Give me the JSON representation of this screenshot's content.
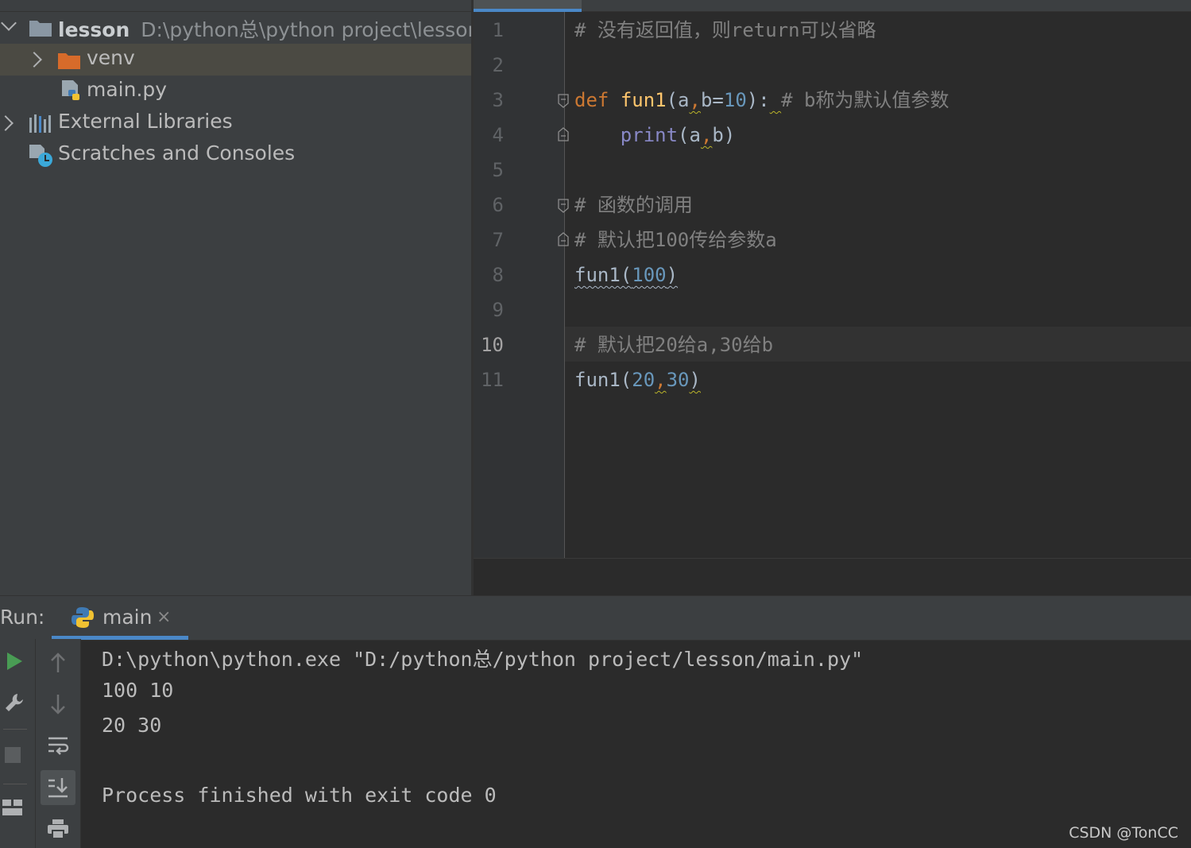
{
  "project_tree": {
    "root": {
      "name": "lesson",
      "path": "D:\\python总\\python project\\lesson"
    },
    "items": [
      {
        "label": "venv",
        "type": "folder",
        "selected": true
      },
      {
        "label": "main.py",
        "type": "python-file"
      },
      {
        "label": "External Libraries",
        "type": "libraries"
      },
      {
        "label": "Scratches and Consoles",
        "type": "scratches"
      }
    ]
  },
  "editor": {
    "current_line": 10,
    "lines": [
      {
        "num": "1",
        "tokens": [
          {
            "t": "# 没有返回值，则return可以省略",
            "c": "comment"
          }
        ]
      },
      {
        "num": "2",
        "tokens": []
      },
      {
        "num": "3",
        "tokens": [
          {
            "t": "def",
            "c": "kw"
          },
          {
            "t": " ",
            "c": "plain"
          },
          {
            "t": "fun1",
            "c": "fn"
          },
          {
            "t": "(a",
            "c": "plain"
          },
          {
            "t": ",",
            "c": "kw",
            "w": "warn"
          },
          {
            "t": "b=",
            "c": "plain"
          },
          {
            "t": "10",
            "c": "num"
          },
          {
            "t": "):",
            "c": "plain"
          },
          {
            "t": " ",
            "c": "plain",
            "w": "warn"
          },
          {
            "t": "# b称为默认值参数",
            "c": "comment"
          }
        ]
      },
      {
        "num": "4",
        "tokens": [
          {
            "t": "    ",
            "c": "plain"
          },
          {
            "t": "print",
            "c": "builtin"
          },
          {
            "t": "(a",
            "c": "plain"
          },
          {
            "t": ",",
            "c": "kw",
            "w": "warn"
          },
          {
            "t": "b)",
            "c": "plain"
          }
        ]
      },
      {
        "num": "5",
        "tokens": []
      },
      {
        "num": "6",
        "tokens": [
          {
            "t": "# 函数的调用",
            "c": "comment"
          }
        ]
      },
      {
        "num": "7",
        "tokens": [
          {
            "t": "# 默认把100传给参数a",
            "c": "comment"
          }
        ]
      },
      {
        "num": "8",
        "tokens": [
          {
            "t": "fun1(",
            "c": "plain",
            "w": "weak"
          },
          {
            "t": "100",
            "c": "num",
            "w": "weak"
          },
          {
            "t": ")",
            "c": "plain",
            "w": "weak"
          }
        ]
      },
      {
        "num": "9",
        "tokens": []
      },
      {
        "num": "10",
        "tokens": [
          {
            "t": "# 默认把20给a,30给b",
            "c": "comment"
          }
        ]
      },
      {
        "num": "11",
        "tokens": [
          {
            "t": "fun1(",
            "c": "plain"
          },
          {
            "t": "20",
            "c": "num"
          },
          {
            "t": ",",
            "c": "kw",
            "w": "warn"
          },
          {
            "t": "30",
            "c": "num"
          },
          {
            "t": ")",
            "c": "plain",
            "w": "warn"
          }
        ]
      }
    ]
  },
  "run": {
    "label": "Run:",
    "tab": "main",
    "tab_close": "×",
    "console": [
      "D:\\python\\python.exe \"D:/python总/python project/lesson/main.py\"",
      "100 10",
      "20 30",
      "",
      "Process finished with exit code 0"
    ],
    "toolbar_left": [
      "run-icon",
      "wrench-icon",
      "stop-icon",
      "layout-icon"
    ],
    "toolbar_right": [
      "up-arrow-icon",
      "down-arrow-icon",
      "soft-wrap-icon",
      "scroll-to-end-icon",
      "print-icon"
    ]
  },
  "watermark": "CSDN @TonCC",
  "colors": {
    "keyword": "#cc7832",
    "function": "#ffc66d",
    "builtin": "#8888c6",
    "number": "#6897bb",
    "comment": "#808080",
    "accent": "#4a88c7"
  }
}
